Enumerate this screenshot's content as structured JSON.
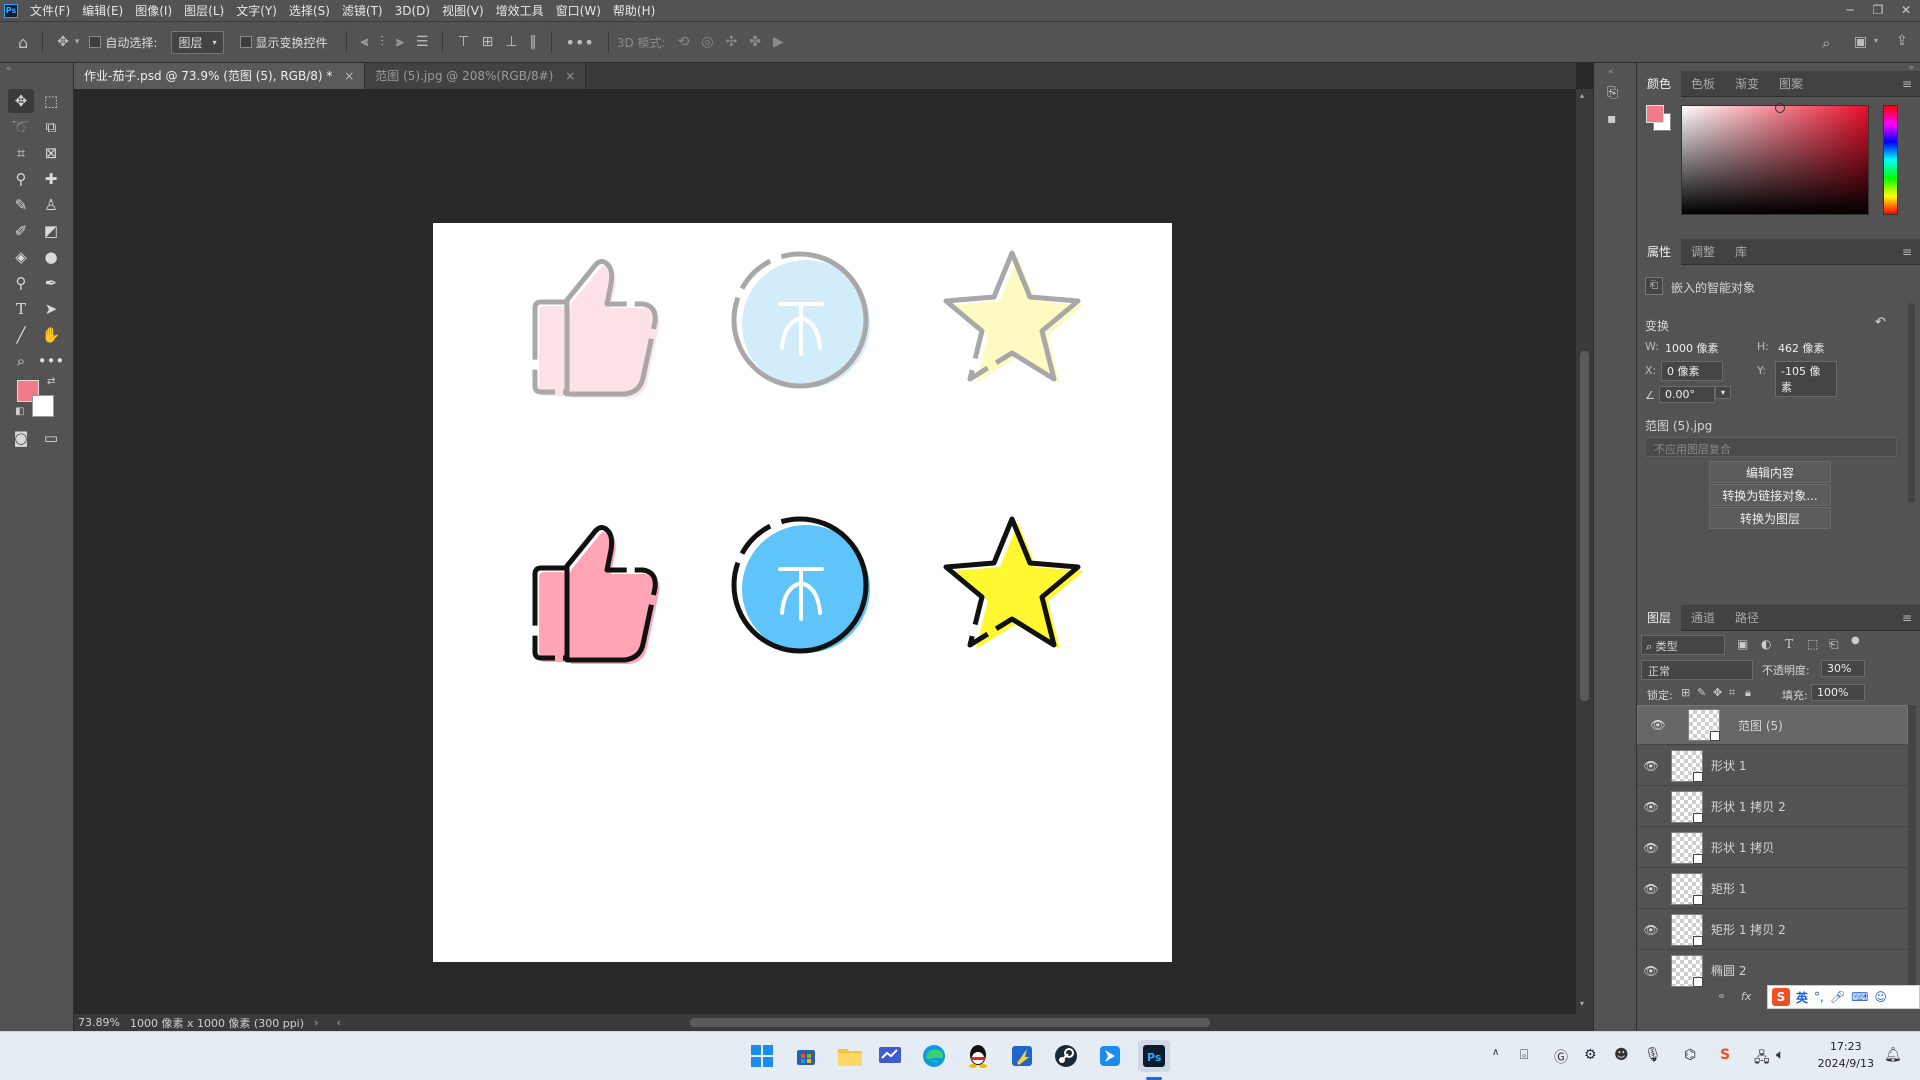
{
  "app": {
    "logo": "Ps",
    "menu": [
      "文件(F)",
      "编辑(E)",
      "图像(I)",
      "图层(L)",
      "文字(Y)",
      "选择(S)",
      "滤镜(T)",
      "3D(D)",
      "视图(V)",
      "增效工具",
      "窗口(W)",
      "帮助(H)"
    ]
  },
  "options": {
    "auto_select_label": "自动选择:",
    "auto_select_value": "图层",
    "show_transform_label": "显示变换控件",
    "mode_3d_label": "3D 模式:"
  },
  "tabs": [
    {
      "label": "作业-茄子.psd @ 73.9% (范图 (5), RGB/8) *",
      "active": true
    },
    {
      "label": "范图 (5).jpg @ 208%(RGB/8#)",
      "active": false
    }
  ],
  "status": {
    "zoom": "73.89%",
    "doc_info": "1000 像素 x 1000 像素 (300 ppi)"
  },
  "color_panel": {
    "tabs": [
      "颜色",
      "色板",
      "渐变",
      "图案"
    ],
    "foreground_color": "#f27b8a",
    "background_color": "#ffffff",
    "picker_hue": "#e8102a"
  },
  "properties": {
    "tabs": [
      "属性",
      "调整",
      "库"
    ],
    "object_type": "嵌入的智能对象",
    "transform_label": "变换",
    "w_label": "W:",
    "w_value": "1000 像素",
    "h_label": "H:",
    "h_value": "462 像素",
    "x_label": "X:",
    "x_value": "0 像素",
    "y_label": "Y:",
    "y_value": "-105 像素",
    "angle_value": "0.00°",
    "source_file": "范图 (5).jpg",
    "layer_comp_placeholder": "不应用图层复合",
    "edit_contents": "编辑内容",
    "convert_linked": "转换为链接对象...",
    "convert_layer": "转换为图层"
  },
  "layers_panel": {
    "tabs": [
      "图层",
      "通道",
      "路径"
    ],
    "filter_label": "类型",
    "blend_mode": "正常",
    "opacity_label": "不透明度:",
    "opacity_value": "30%",
    "lock_label": "锁定:",
    "fill_label": "填充:",
    "fill_value": "100%",
    "layers": [
      {
        "name": "范图 (5)",
        "selected": true
      },
      {
        "name": "形状 1",
        "selected": false
      },
      {
        "name": "形状 1 拷贝 2",
        "selected": false
      },
      {
        "name": "形状 1 拷贝",
        "selected": false
      },
      {
        "name": "矩形 1",
        "selected": false
      },
      {
        "name": "矩形 1 拷贝 2",
        "selected": false
      },
      {
        "name": "椭圆 2",
        "selected": false
      }
    ]
  },
  "ime": {
    "lang": "英"
  },
  "taskbar": {
    "time": "17:23",
    "date": "2024/9/13"
  },
  "canvas_icons": {
    "pink_light": "#fde3e8",
    "pink": "#ffa5b5",
    "blue_light": "#d3ecfa",
    "blue": "#5ec4f9",
    "yellow_light": "#fdfbc1",
    "yellow": "#fff830",
    "gray_outline": "#a8a8a8",
    "black_outline": "#111111"
  }
}
